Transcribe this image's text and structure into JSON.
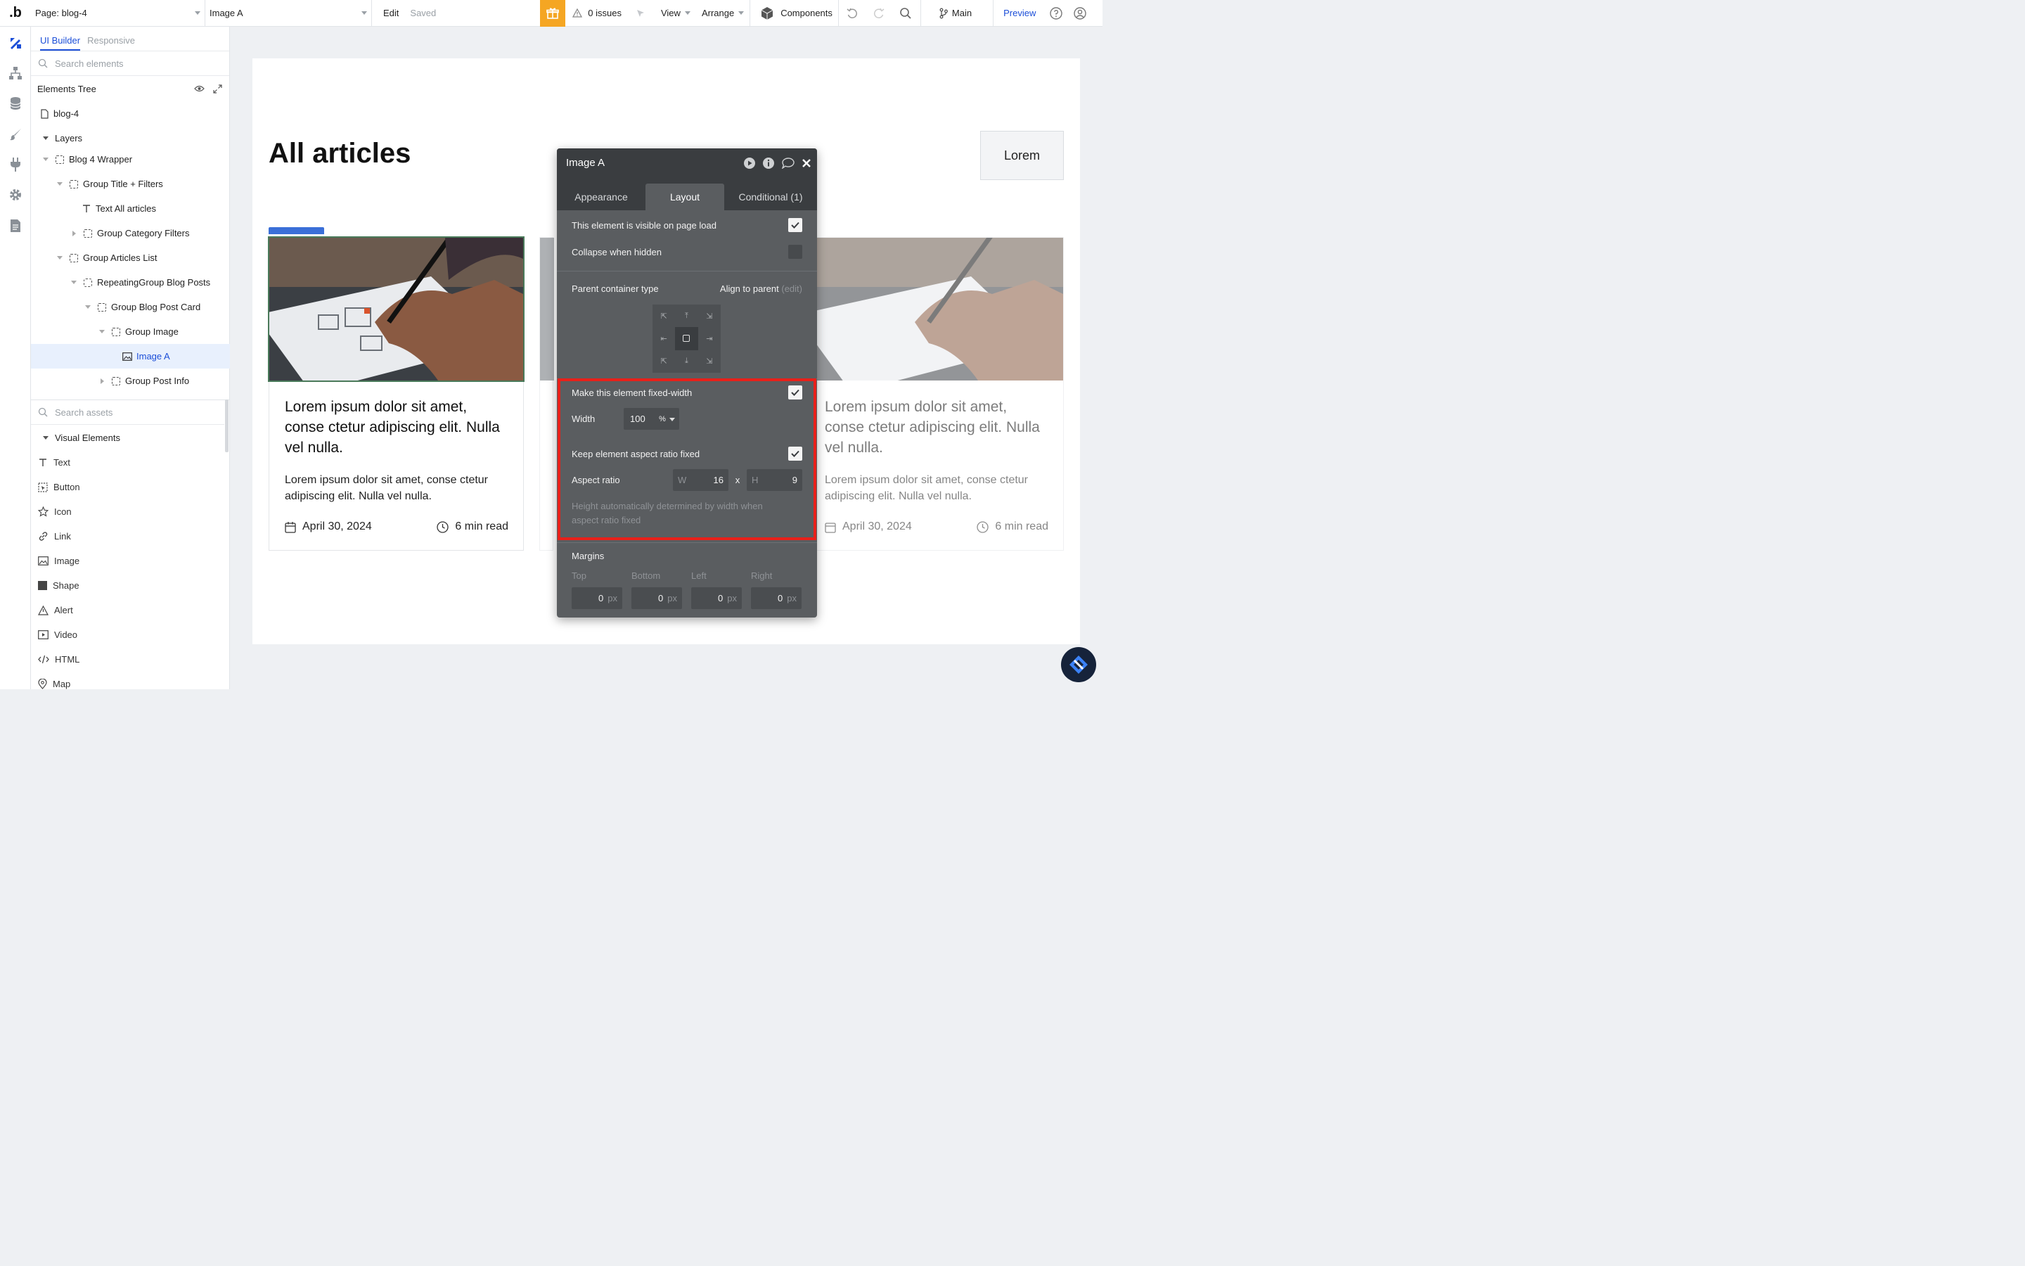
{
  "topbar": {
    "page_label": "Page: blog-4",
    "element_select": "Image A",
    "edit": "Edit",
    "saved": "Saved",
    "issues": "0 issues",
    "view": "View",
    "arrange": "Arrange",
    "components": "Components",
    "branch": "Main",
    "preview": "Preview"
  },
  "left_panel": {
    "tabs": [
      "UI Builder",
      "Responsive"
    ],
    "search_elements_placeholder": "Search elements",
    "tree_title": "Elements Tree",
    "tree": [
      {
        "label": "blog-4",
        "icon": "page-icon",
        "indent": 0
      },
      {
        "label": "Layers",
        "icon": "none",
        "indent": 0
      },
      {
        "label": "Blog 4 Wrapper",
        "icon": "group-icon",
        "indent": 1
      },
      {
        "label": "Group Title + Filters",
        "icon": "group-icon",
        "indent": 2
      },
      {
        "label": "Text All articles",
        "icon": "text-icon",
        "indent": 3
      },
      {
        "label": "Group Category Filters",
        "icon": "group-icon",
        "indent": 3
      },
      {
        "label": "Group Articles List",
        "icon": "group-icon",
        "indent": 2
      },
      {
        "label": "RepeatingGroup Blog Posts",
        "icon": "repeating-group-icon",
        "indent": 3
      },
      {
        "label": "Group Blog Post Card",
        "icon": "group-icon",
        "indent": 4
      },
      {
        "label": "Group Image",
        "icon": "group-icon",
        "indent": 5
      },
      {
        "label": "Image A",
        "icon": "image-icon",
        "indent": 6
      },
      {
        "label": "Group Post Info",
        "icon": "group-icon",
        "indent": 5
      }
    ],
    "search_assets_placeholder": "Search assets",
    "assets_section": "Visual Elements",
    "assets": [
      "Text",
      "Button",
      "Icon",
      "Link",
      "Image",
      "Shape",
      "Alert",
      "Video",
      "HTML",
      "Map"
    ]
  },
  "canvas": {
    "page_title": "All articles",
    "lorem_button": "Lorem",
    "cards": [
      {
        "title": "Lorem ipsum dolor sit amet, conse ctetur adipiscing elit. Nulla vel nulla.",
        "body": "Lorem ipsum dolor sit amet, conse ctetur adipiscing elit. Nulla vel nulla.",
        "date": "April 30, 2024",
        "read_time": "6 min read"
      },
      {
        "title": "Lorem ipsum dolor sit amet, conse ctetur adipiscing elit. Nulla vel nulla.",
        "body": "Lorem ipsum dolor sit amet, conse ctetur adipiscing elit. Nulla vel nulla.",
        "date": "April 30, 2024",
        "read_time": "6 min read"
      }
    ]
  },
  "editor": {
    "title": "Image A",
    "tabs": [
      "Appearance",
      "Layout",
      "Conditional (1)"
    ],
    "active_tab": "Layout",
    "visible_on_load": "This element is visible on page load",
    "collapse_hidden": "Collapse when hidden",
    "parent_container_type": "Parent container type",
    "align_to_parent": "Align to parent",
    "edit_link": "(edit)",
    "fixed_width": "Make this element fixed-width",
    "width_label": "Width",
    "width_value": "100",
    "width_unit": "%",
    "keep_aspect": "Keep element aspect ratio fixed",
    "aspect_label": "Aspect ratio",
    "aspect_w_prefix": "W",
    "aspect_w": "16",
    "aspect_x": "x",
    "aspect_h_prefix": "H",
    "aspect_h": "9",
    "aspect_note": "Height automatically determined by width when aspect ratio fixed",
    "margins_label": "Margins",
    "margin_labels": [
      "Top",
      "Bottom",
      "Left",
      "Right"
    ],
    "margin_values": [
      "0",
      "0",
      "0",
      "0"
    ],
    "margin_unit": "px"
  },
  "colors": {
    "accent": "#1b4ed8",
    "highlight": "#e8201a",
    "gift": "#f5a623",
    "editor_bg": "#5a5d60"
  }
}
